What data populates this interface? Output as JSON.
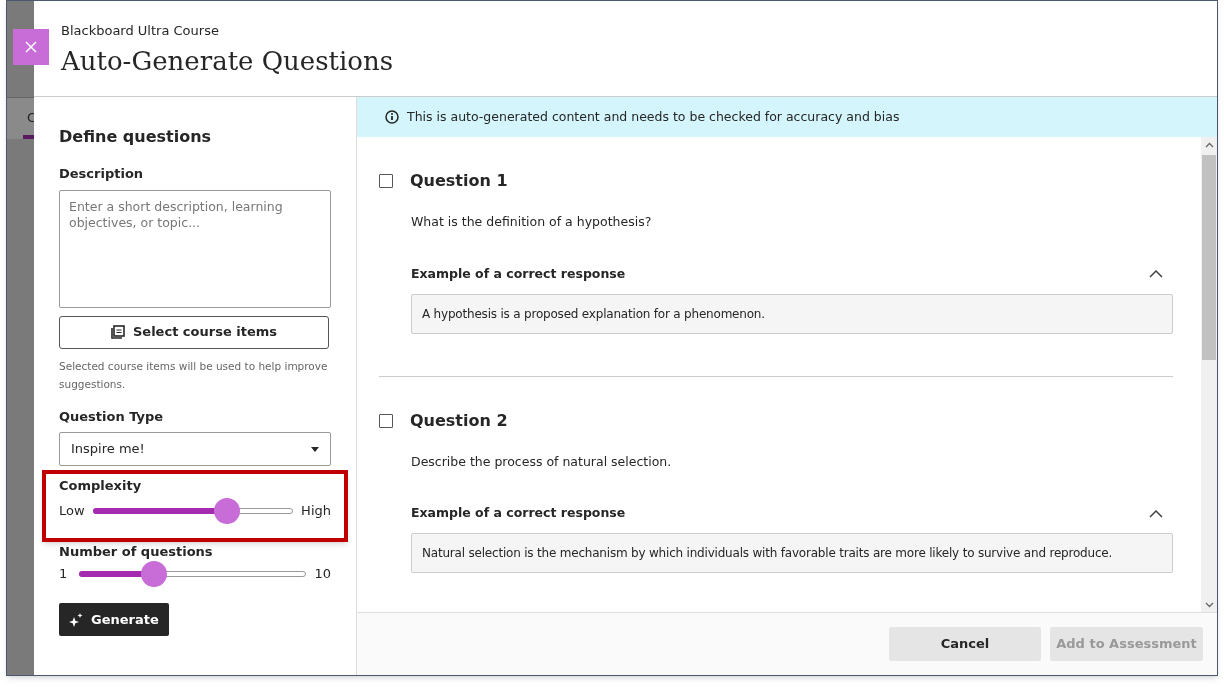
{
  "background": {
    "tab_text": "C"
  },
  "header": {
    "course": "Blackboard Ultra Course",
    "title": "Auto-Generate Questions"
  },
  "define": {
    "heading": "Define questions",
    "description": {
      "label": "Description",
      "placeholder": "Enter a short description, learning objectives, or topic..."
    },
    "select_button": "Select course items",
    "select_hint": "Selected course items will be used to help improve suggestions.",
    "question_type": {
      "label": "Question Type",
      "value": "Inspire me!"
    },
    "complexity": {
      "label": "Complexity",
      "min_label": "Low",
      "max_label": "High",
      "level": 0.67,
      "highlighted": true
    },
    "number": {
      "label": "Number of questions",
      "min_label": "1",
      "max_label": "10",
      "level": 0.33
    },
    "generate_button": "Generate"
  },
  "banner": "This is auto-generated content and needs to be checked for accuracy and bias",
  "questions": [
    {
      "title": "Question 1",
      "checked": false,
      "prompt": "What is the definition of a hypothesis?",
      "answer_label": "Example of a correct response",
      "expanded": true,
      "answer": "A hypothesis is a proposed explanation for a phenomenon."
    },
    {
      "title": "Question 2",
      "checked": false,
      "prompt": "Describe the process of natural selection.",
      "answer_label": "Example of a correct response",
      "expanded": true,
      "answer": "Natural selection is the mechanism by which individuals with favorable traits are more likely to survive and reproduce."
    }
  ],
  "footer": [
    {
      "label": "Cancel",
      "disabled": false
    },
    {
      "label": "Add to Assessment",
      "disabled": true
    }
  ]
}
